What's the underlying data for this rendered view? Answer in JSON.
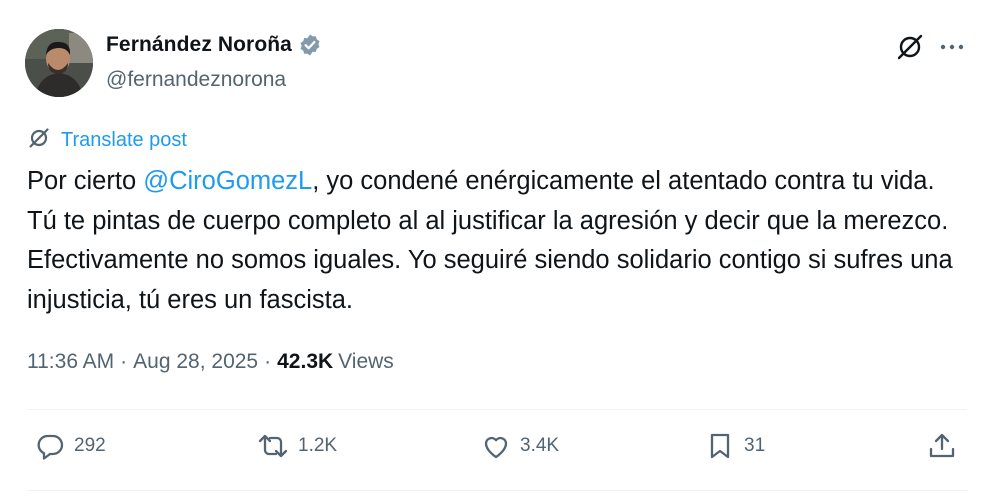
{
  "author": {
    "display_name": "Fernández Noroña",
    "handle": "@fernandeznorona"
  },
  "translate_label": "Translate post",
  "post": {
    "text_before": "Por cierto ",
    "mention": "@CiroGomezL",
    "text_after": ", yo condené enérgicamente el atentado contra tu vida. Tú te pintas de cuerpo completo al al justificar la agresión y decir que la merezco. Efectivamente no somos iguales. Yo seguiré siendo solidario contigo si sufres una injusticia, tú eres un fascista."
  },
  "meta": {
    "time": "11:36 AM",
    "separator": "·",
    "date": "Aug 28, 2025",
    "views_count": "42.3K",
    "views_label": "Views"
  },
  "actions": {
    "replies": "292",
    "reposts": "1.2K",
    "likes": "3.4K",
    "bookmarks": "31"
  },
  "icons": {
    "verified": "verified-badge-icon",
    "grok": "grok-icon",
    "more": "more-icon",
    "translate": "translate-icon",
    "reply": "reply-icon",
    "repost": "repost-icon",
    "like": "like-icon",
    "bookmark": "bookmark-icon",
    "share": "share-icon"
  },
  "colors": {
    "link": "#1d9bf0",
    "secondary_text": "#536471",
    "primary_text": "#0f1419"
  }
}
